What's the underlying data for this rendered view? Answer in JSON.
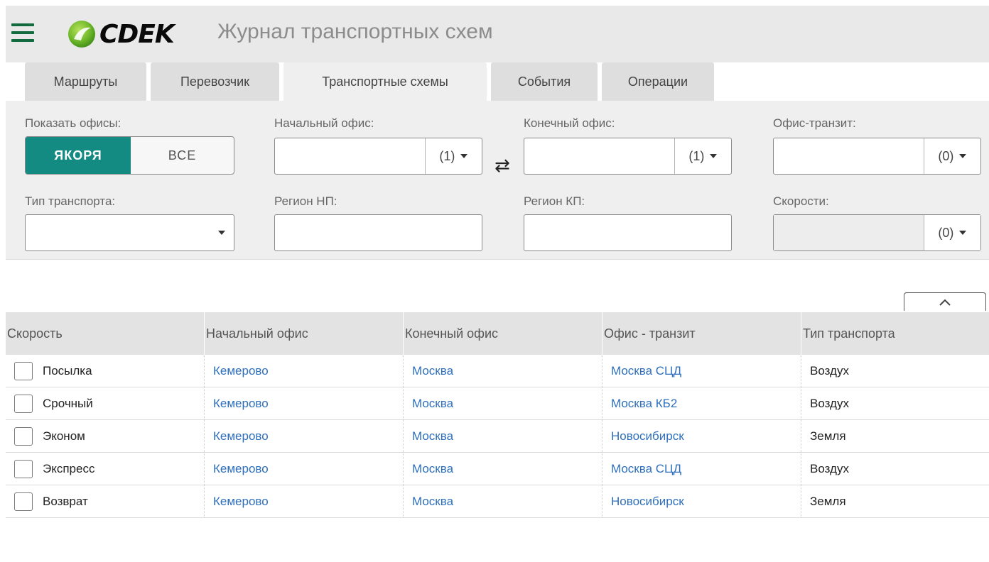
{
  "header": {
    "logo_text": "CDEK",
    "title": "Журнал транспортных схем",
    "brand_color": "#116b3e"
  },
  "tabs": [
    {
      "label": "Маршруты",
      "active": false
    },
    {
      "label": "Перевозчик",
      "active": false
    },
    {
      "label": "Транспортные схемы",
      "active": true
    },
    {
      "label": "События",
      "active": false
    },
    {
      "label": "Операции",
      "active": false
    }
  ],
  "filters": {
    "show_offices": {
      "label": "Показать офисы:",
      "options": [
        "ЯКОРЯ",
        "ВСЕ"
      ],
      "selected": "ЯКОРЯ",
      "active_color": "#138b83"
    },
    "start_office": {
      "label": "Начальный офис:",
      "value": "",
      "count": "(1)"
    },
    "end_office": {
      "label": "Конечный офис:",
      "value": "",
      "count": "(1)"
    },
    "transit_office": {
      "label": "Офис-транзит:",
      "value": "",
      "count": "(0)"
    },
    "transport_type": {
      "label": "Тип транспорта:",
      "value": ""
    },
    "region_start": {
      "label": "Регион НП:",
      "value": ""
    },
    "region_end": {
      "label": "Регион КП:",
      "value": ""
    },
    "speeds": {
      "label": "Скорости:",
      "value": "",
      "count": "(0)"
    },
    "swap_icon": "swap-arrows-icon"
  },
  "table": {
    "columns": [
      "Скорость",
      "Начальный офис",
      "Конечный офис",
      "Офис - транзит",
      "Тип транспорта"
    ],
    "rows": [
      {
        "speed": "Посылка",
        "start": "Кемерово",
        "end": "Москва",
        "transit": "Москва СЦД",
        "transport": "Воздух"
      },
      {
        "speed": "Срочный",
        "start": "Кемерово",
        "end": "Москва",
        "transit": "Москва КБ2",
        "transport": "Воздух"
      },
      {
        "speed": "Эконом",
        "start": "Кемерово",
        "end": "Москва",
        "transit": "Новосибирск",
        "transport": "Земля"
      },
      {
        "speed": "Экспресс",
        "start": "Кемерово",
        "end": "Москва",
        "transit": "Москва СЦД",
        "transport": "Воздух"
      },
      {
        "speed": "Возврат",
        "start": "Кемерово",
        "end": "Москва",
        "transit": "Новосибирск",
        "transport": "Земля"
      }
    ],
    "link_color": "#2e6fbd"
  }
}
